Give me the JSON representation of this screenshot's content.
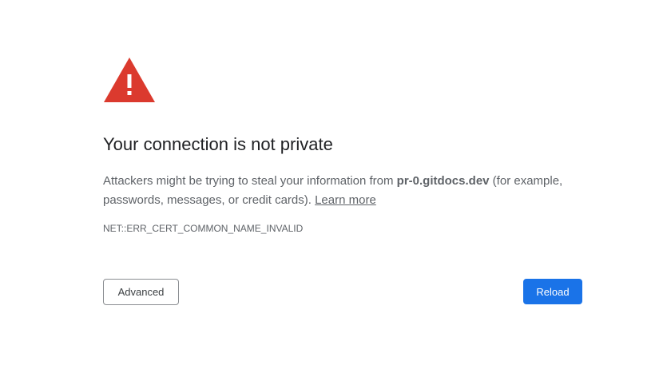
{
  "icon": {
    "name": "warning-triangle-icon",
    "color": "#db3a2e",
    "glyph_color": "#ffffff"
  },
  "heading": "Your connection is not private",
  "description": {
    "prefix": "Attackers might be trying to steal your information from ",
    "domain": "pr-0.gitdocs.dev",
    "suffix": " (for example, passwords, messages, or credit cards). ",
    "link_label": "Learn more"
  },
  "error_code": "NET::ERR_CERT_COMMON_NAME_INVALID",
  "buttons": {
    "advanced_label": "Advanced",
    "reload_label": "Reload"
  },
  "colors": {
    "accent": "#1a73e8",
    "warning": "#db3a2e",
    "text_primary": "#202124",
    "text_secondary": "#5f6368"
  }
}
